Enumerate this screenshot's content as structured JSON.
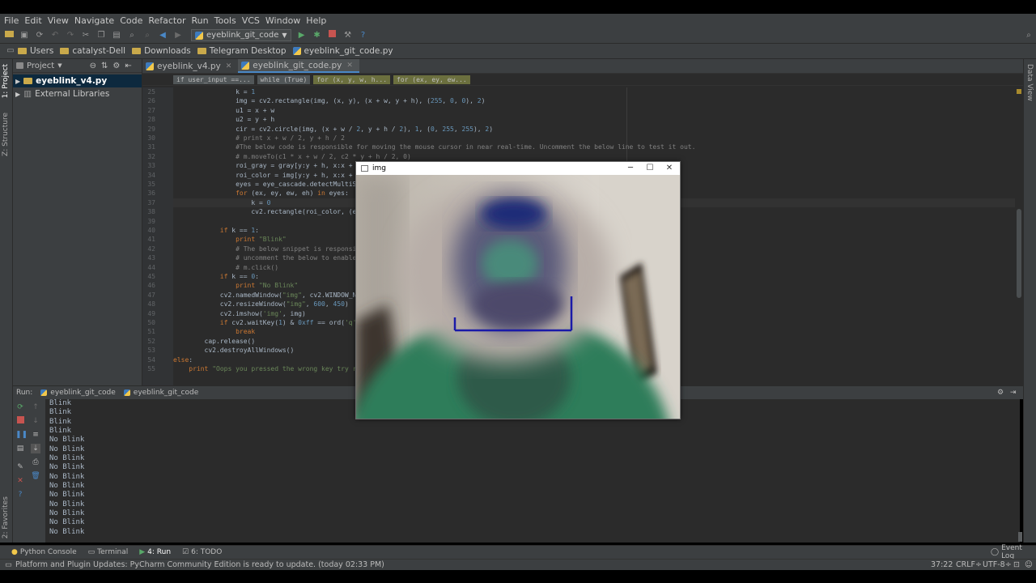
{
  "menu": [
    "File",
    "Edit",
    "View",
    "Navigate",
    "Code",
    "Refactor",
    "Run",
    "Tools",
    "VCS",
    "Window",
    "Help"
  ],
  "toolbar": {
    "run_config": "eyeblink_git_code"
  },
  "navbar": {
    "crumbs": [
      "Users",
      "catalyst-Dell",
      "Downloads",
      "Telegram Desktop",
      "eyeblink_git_code.py"
    ]
  },
  "left_strip": {
    "project": "1: Project",
    "structure": "Z: Structure",
    "favorites": "2: Favorites"
  },
  "right_strip": {
    "data_view": "Data View"
  },
  "project": {
    "header": "Project",
    "items": [
      {
        "label": "eyeblink_v4.py"
      },
      {
        "label": "External Libraries"
      }
    ]
  },
  "editor": {
    "tabs": [
      {
        "label": "eyeblink_v4.py"
      },
      {
        "label": "eyeblink_git_code.py"
      }
    ],
    "breadcrumbs": [
      "if user_input ==...",
      "while (True)",
      "for (x, y, w, h...",
      "for (ex, ey, ew..."
    ],
    "lines": [
      {
        "n": "25",
        "t": "                k = 1"
      },
      {
        "n": "26",
        "t": "                img = cv2.rectangle(img, (x, y), (x + w, y + h), (255, 0, 0), 2)"
      },
      {
        "n": "27",
        "t": "                u1 = x + w"
      },
      {
        "n": "28",
        "t": "                u2 = y + h"
      },
      {
        "n": "29",
        "t": "                cir = cv2.circle(img, (x + w / 2, y + h / 2), 1, (0, 255, 255), 2)"
      },
      {
        "n": "30",
        "t": "                # print x + w / 2, y + h / 2"
      },
      {
        "n": "31",
        "t": "                #The below code is responsible for moving the mouse cursor in near real-time. Uncomment the below line to test it out."
      },
      {
        "n": "32",
        "t": "                # m.moveTo(c1 * x + w / 2, c2 * y + h / 2, 0)"
      },
      {
        "n": "33",
        "t": "                roi_gray = gray[y:y + h, x:x + w]"
      },
      {
        "n": "34",
        "t": "                roi_color = img[y:y + h, x:x + w]"
      },
      {
        "n": "35",
        "t": "                eyes = eye_cascade.detectMultiScale(roi_gray)"
      },
      {
        "n": "36",
        "t": "                for (ex, ey, ew, eh) in eyes:"
      },
      {
        "n": "37",
        "t": "                    k = 0"
      },
      {
        "n": "38",
        "t": "                    cv2.rectangle(roi_color, (ex, ey), (ex + ew, ey + eh), (0, 255, 0), 2)"
      },
      {
        "n": "39",
        "t": ""
      },
      {
        "n": "40",
        "t": "            if k == 1:"
      },
      {
        "n": "41",
        "t": "                print \"Blink\""
      },
      {
        "n": "42",
        "t": "                # The below snippet is responsible for clicking"
      },
      {
        "n": "43",
        "t": "                # uncomment the below to enable mouse click"
      },
      {
        "n": "44",
        "t": "                # m.click()"
      },
      {
        "n": "45",
        "t": "            if k == 0:"
      },
      {
        "n": "46",
        "t": "                print \"No Blink\""
      },
      {
        "n": "47",
        "t": "            cv2.namedWindow(\"img\", cv2.WINDOW_NORMAL)"
      },
      {
        "n": "48",
        "t": "            cv2.resizeWindow(\"img\", 600, 450)"
      },
      {
        "n": "49",
        "t": "            cv2.imshow('img', img)"
      },
      {
        "n": "50",
        "t": "            if cv2.waitKey(1) & 0xff == ord('q'):"
      },
      {
        "n": "51",
        "t": "                break"
      },
      {
        "n": "52",
        "t": "        cap.release()"
      },
      {
        "n": "53",
        "t": "        cv2.destroyAllWindows()"
      },
      {
        "n": "54",
        "t": "else:"
      },
      {
        "n": "55",
        "t": "    print \"Oops you pressed the wrong key try re"
      }
    ]
  },
  "run_panel": {
    "label": "Run:",
    "tabs": [
      "eyeblink_git_code",
      "eyeblink_git_code"
    ],
    "output": [
      "Blink",
      "Blink",
      "Blink",
      "Blink",
      "No Blink",
      "No Blink",
      "No Blink",
      "No Blink",
      "No Blink",
      "No Blink",
      "No Blink",
      "No Blink",
      "No Blink",
      "No Blink",
      "No Blink"
    ]
  },
  "bottom_tabs": [
    "Python Console",
    "Terminal",
    "4: Run",
    "6: TODO"
  ],
  "event_log": "Event Log",
  "status": {
    "message": "Platform and Plugin Updates: PyCharm Community Edition is ready to update. (today 02:33 PM)",
    "position": "37:22",
    "line_sep": "CRLF÷",
    "encoding": "UTF-8÷"
  },
  "img_window": {
    "title": "img"
  },
  "colors": {
    "accent": "#4a88c7",
    "bg_panel": "#3c3f41",
    "bg_editor": "#2b2b2b",
    "detection_box": "#1a1aa8"
  }
}
